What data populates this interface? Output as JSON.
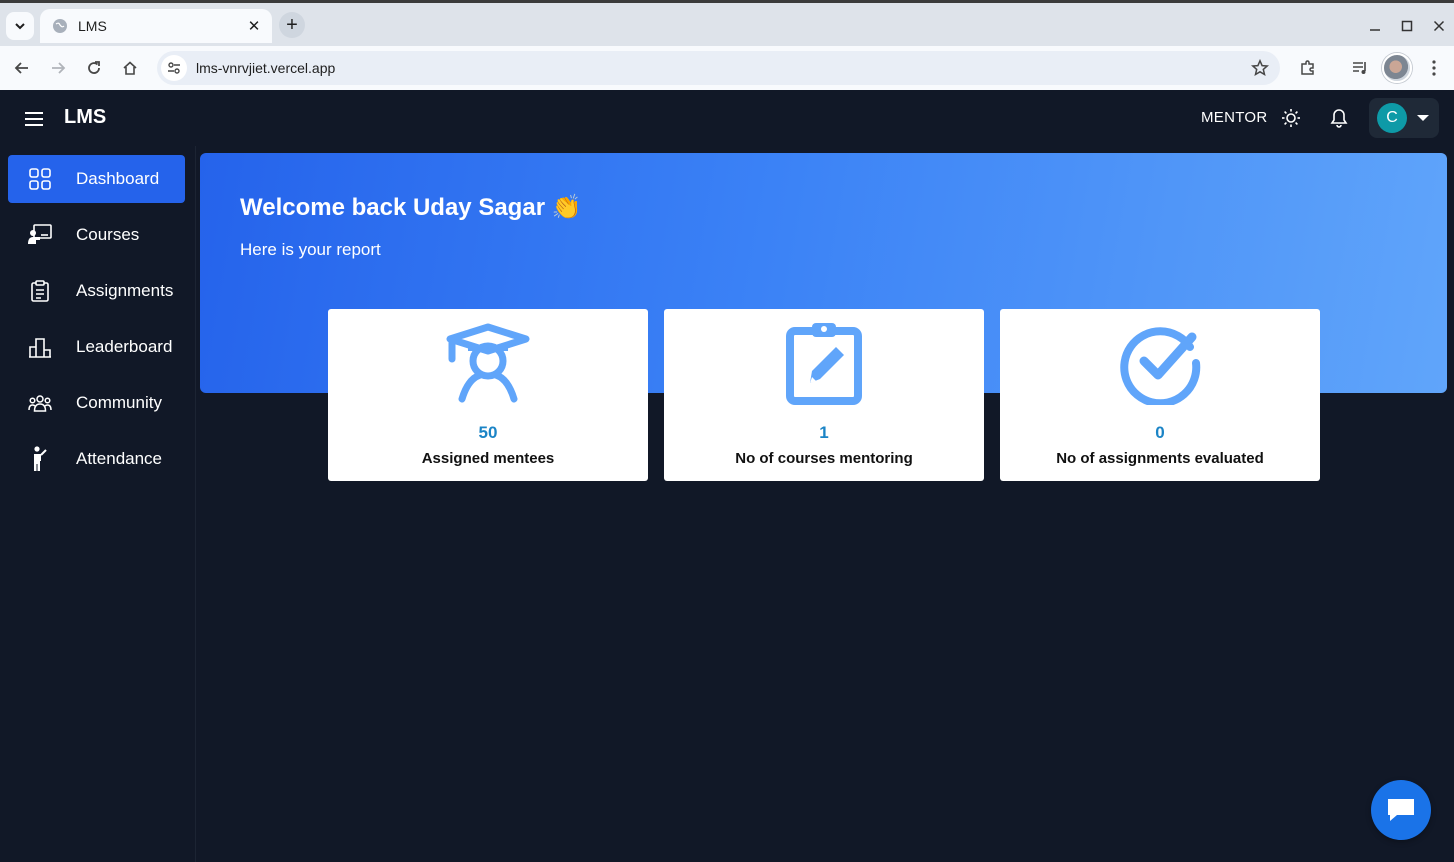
{
  "browser": {
    "tab_title": "LMS",
    "url": "lms-vnrvjiet.vercel.app"
  },
  "app": {
    "brand": "LMS",
    "role": "MENTOR",
    "avatar_initial": "C"
  },
  "sidebar": {
    "items": [
      {
        "label": "Dashboard",
        "icon": "dashboard-grid-icon",
        "active": true
      },
      {
        "label": "Courses",
        "icon": "presentation-icon"
      },
      {
        "label": "Assignments",
        "icon": "clipboard-list-icon"
      },
      {
        "label": "Leaderboard",
        "icon": "podium-icon"
      },
      {
        "label": "Community",
        "icon": "people-group-icon"
      },
      {
        "label": "Attendance",
        "icon": "person-standing-icon"
      }
    ]
  },
  "banner": {
    "welcome": "Welcome back Uday Sagar 👏",
    "subtitle": "Here is your report"
  },
  "stats": [
    {
      "value": "50",
      "label": "Assigned mentees",
      "icon": "student-graduate-icon"
    },
    {
      "value": "1",
      "label": "No of courses mentoring",
      "icon": "clipboard-edit-icon"
    },
    {
      "value": "0",
      "label": "No of assignments evaluated",
      "icon": "check-circle-icon"
    }
  ],
  "colors": {
    "background": "#111827",
    "accent": "#2563eb",
    "stat_icon": "#60a5fa",
    "stat_value": "#1b84c6"
  }
}
